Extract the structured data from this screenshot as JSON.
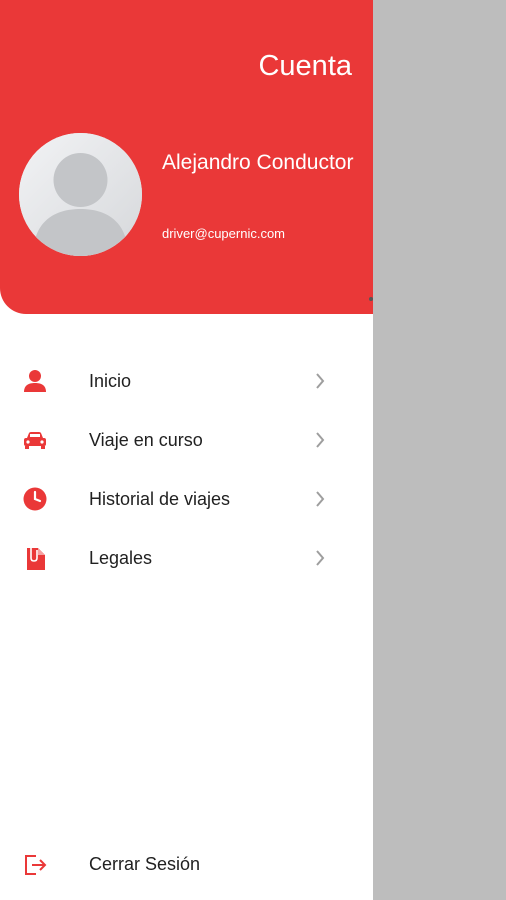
{
  "header": {
    "title": "Cuenta",
    "user_name": "Alejandro Conductor",
    "user_email": "driver@cupernic.com"
  },
  "menu": {
    "items": [
      {
        "label": "Inicio",
        "icon": "person-icon"
      },
      {
        "label": "Viaje en curso",
        "icon": "car-icon"
      },
      {
        "label": "Historial de viajes",
        "icon": "clock-icon"
      },
      {
        "label": "Legales",
        "icon": "document-icon"
      }
    ]
  },
  "footer": {
    "logout_label": "Cerrar Sesión",
    "logout_icon": "logout-icon"
  },
  "colors": {
    "accent": "#ea3838",
    "overlay": "#bdbdbd",
    "text": "#212121",
    "chevron": "#9e9e9e"
  }
}
